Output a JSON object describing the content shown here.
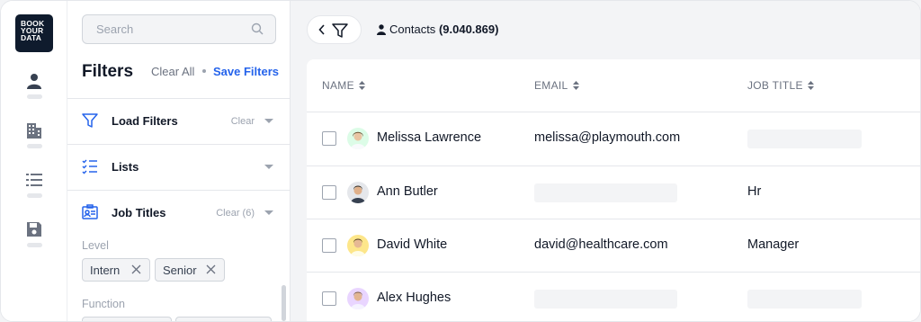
{
  "logo": {
    "lines": [
      "BOOK",
      "YOUR",
      "DATA"
    ]
  },
  "rail": {
    "items": [
      "person-icon",
      "building-icon",
      "list-icon",
      "save-icon"
    ]
  },
  "filters": {
    "search_placeholder": "Search",
    "title": "Filters",
    "clear_all": "Clear All",
    "save_filters": "Save Filters",
    "sections": [
      {
        "label": "Load Filters",
        "clear": "Clear",
        "icon": "funnel-icon"
      },
      {
        "label": "Lists",
        "clear": "",
        "icon": "checklist-icon"
      },
      {
        "label": "Job Titles",
        "clear": "Clear (6)",
        "icon": "id-card-icon"
      }
    ],
    "level_label": "Level",
    "chips": [
      "Intern",
      "Senior"
    ],
    "function_label": "Function"
  },
  "header": {
    "contacts_label": "Contacts",
    "contacts_count": "(9.040.869)"
  },
  "table": {
    "columns": [
      "NAME",
      "EMAIL",
      "JOB TITLE"
    ],
    "rows": [
      {
        "name": "Melissa Lawrence",
        "email": "melissa@playmouth.com",
        "job": ""
      },
      {
        "name": "Ann Butler",
        "email": "",
        "job": "Hr"
      },
      {
        "name": "David White",
        "email": "david@healthcare.com",
        "job": "Manager"
      },
      {
        "name": "Alex Hughes",
        "email": "",
        "job": ""
      }
    ]
  },
  "colors": {
    "accent": "#2563eb",
    "logo_bg": "#0f1b2d",
    "placeholder": "#f3f4f6"
  }
}
